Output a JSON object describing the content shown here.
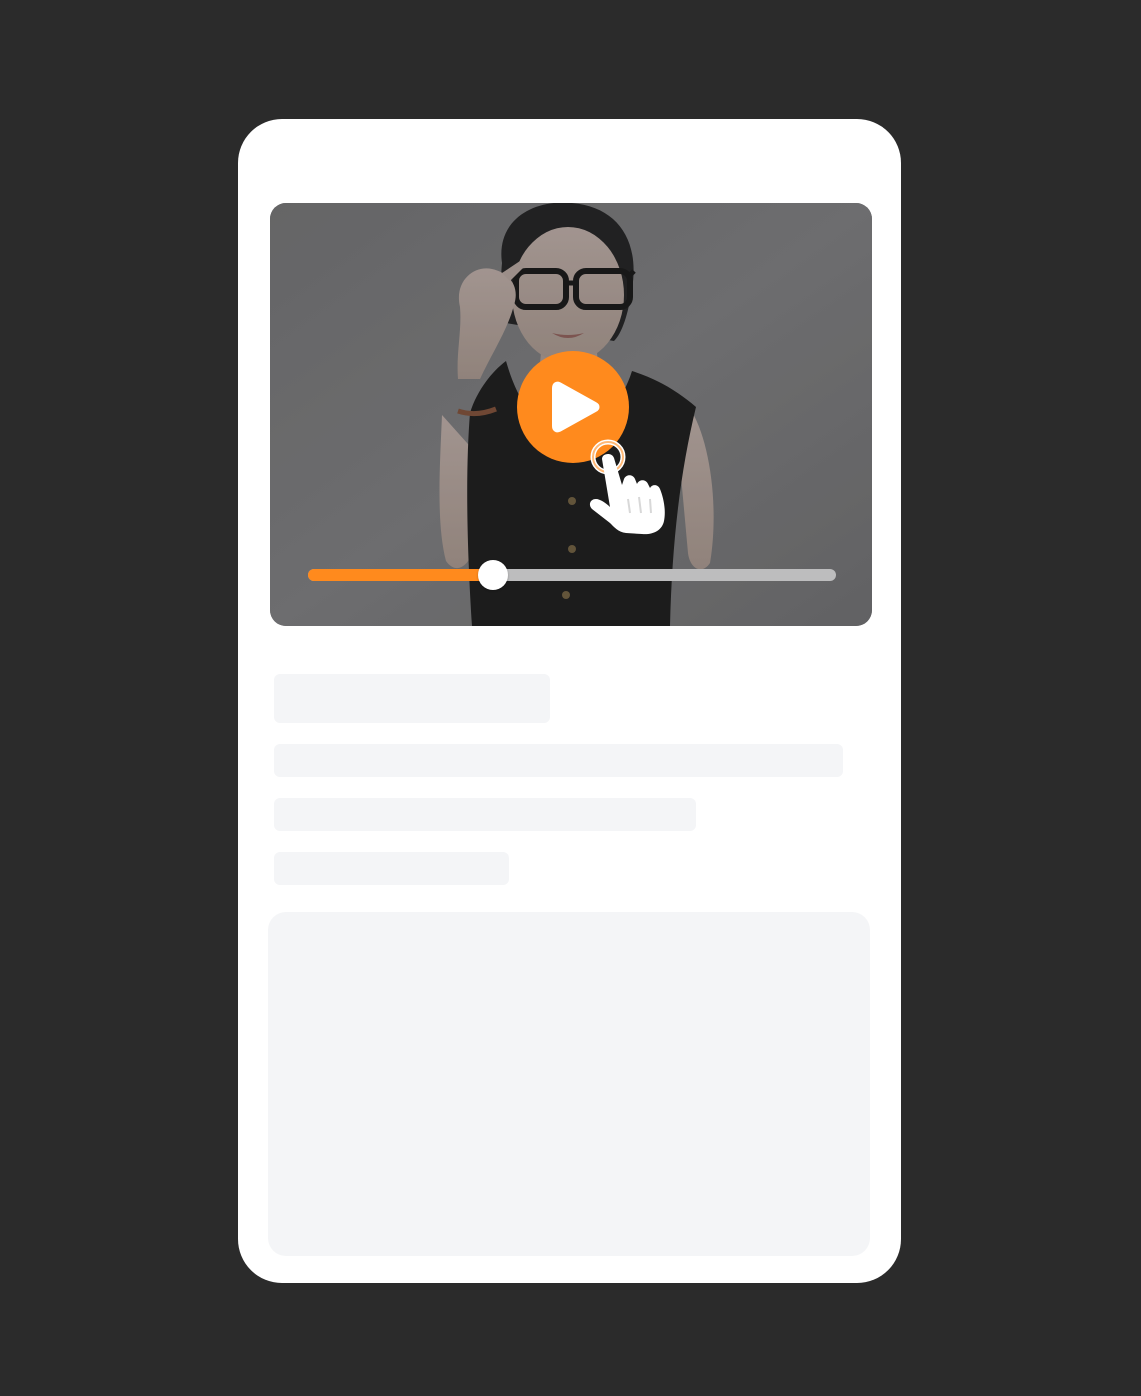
{
  "player": {
    "progress_fraction": 0.35,
    "accent_color": "#ff8a1d",
    "track_color": "#bdbdbe",
    "play_icon": "play-icon",
    "cursor_icon": "hand-pointer-icon"
  },
  "placeholder_lines": 4,
  "placeholder_color": "#f4f5f7"
}
